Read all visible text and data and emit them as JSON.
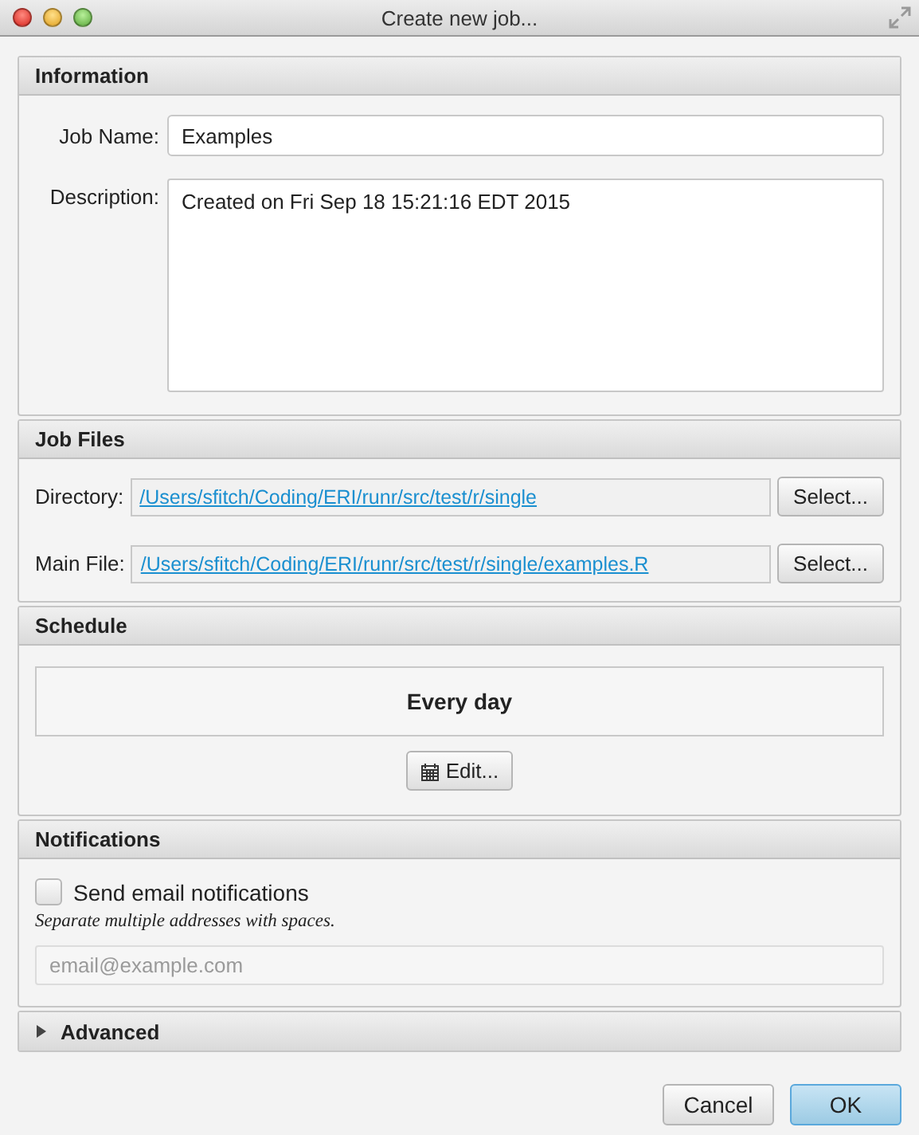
{
  "window": {
    "title": "Create new job..."
  },
  "information": {
    "title": "Information",
    "job_name_label": "Job Name:",
    "job_name": "Examples",
    "description_label": "Description:",
    "description": "Created on Fri Sep 18 15:21:16 EDT 2015"
  },
  "job_files": {
    "title": "Job Files",
    "rows": [
      {
        "label": "Directory:",
        "path": "/Users/sfitch/Coding/ERI/runr/src/test/r/single",
        "button": "Select..."
      },
      {
        "label": "Main File:",
        "path": "/Users/sfitch/Coding/ERI/runr/src/test/r/single/examples.R",
        "button": "Select..."
      }
    ]
  },
  "schedule": {
    "title": "Schedule",
    "summary": "Every day",
    "button": "Edit..."
  },
  "notifications": {
    "title": "Notifications",
    "checkbox_label": "Send email notifications",
    "checked": false,
    "hint": "Separate multiple addresses with spaces.",
    "placeholder": "email@example.com"
  },
  "advanced": {
    "title": "Advanced",
    "expanded": false
  },
  "buttons": [
    {
      "label": "Cancel",
      "default": false
    },
    {
      "label": "OK",
      "default": true
    }
  ]
}
